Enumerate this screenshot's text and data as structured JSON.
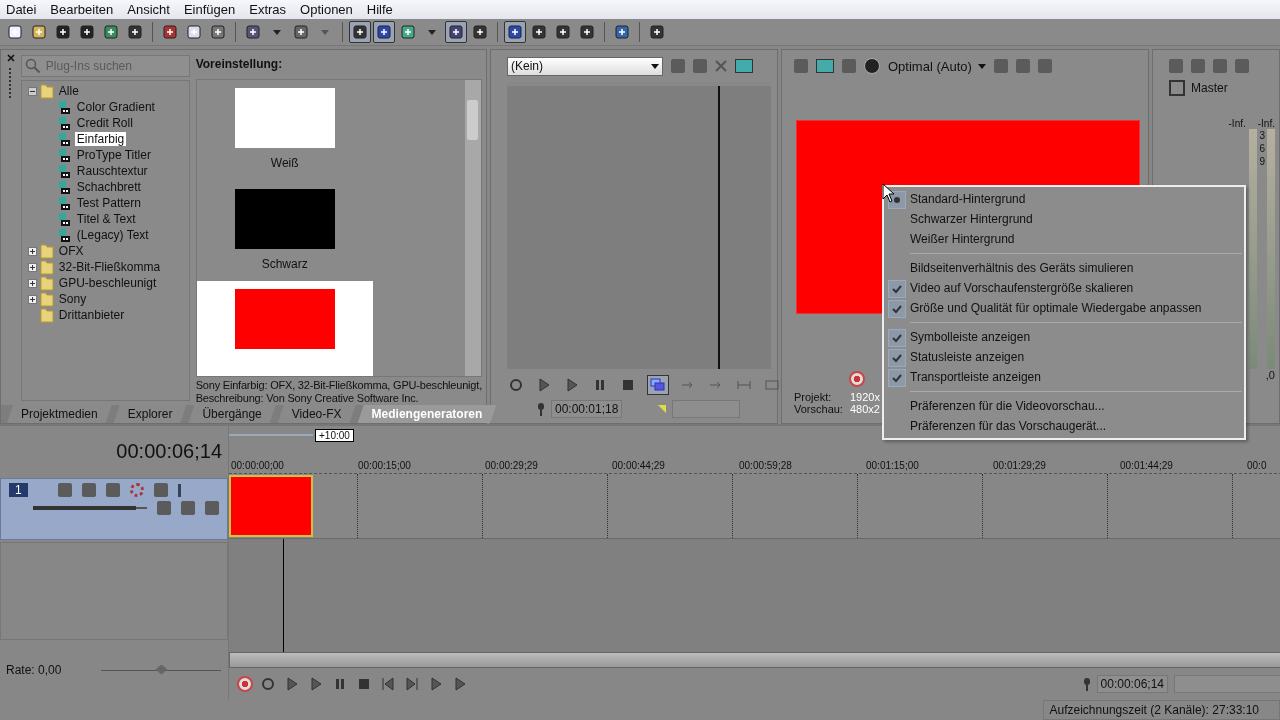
{
  "menu": [
    "Datei",
    "Bearbeiten",
    "Ansicht",
    "Einfügen",
    "Extras",
    "Optionen",
    "Hilfe"
  ],
  "toolbar": [
    {
      "pressed": false
    },
    {
      "pressed": false
    },
    {
      "pressed": false
    },
    {
      "pressed": false
    },
    {
      "pressed": false
    },
    {
      "pressed": false
    },
    {
      "pressed": false
    },
    {
      "pressed": false
    },
    {
      "pressed": false
    },
    {
      "pressed": false
    },
    {
      "pressed": false
    },
    {
      "pressed": false
    },
    {
      "pressed": false
    },
    {
      "pressed": true
    },
    {
      "pressed": true
    },
    {
      "pressed": false
    },
    {
      "pressed": false
    },
    {
      "pressed": true
    },
    {
      "pressed": false
    },
    {
      "pressed": true
    },
    {
      "pressed": false
    },
    {
      "pressed": false
    },
    {
      "pressed": false
    },
    {
      "pressed": false
    },
    {
      "pressed": false
    }
  ],
  "plugins": {
    "search": {
      "placeholder": "Plug-Ins suchen"
    },
    "tree": [
      {
        "label": "Alle",
        "expanded": true,
        "selected": false,
        "children": [
          {
            "label": "Color Gradient",
            "selected": false
          },
          {
            "label": "Credit Roll",
            "selected": false
          },
          {
            "label": "Einfarbig",
            "selected": true
          },
          {
            "label": "ProType Titler",
            "selected": false
          },
          {
            "label": "Rauschtextur",
            "selected": false
          },
          {
            "label": "Schachbrett",
            "selected": false
          },
          {
            "label": "Test Pattern",
            "selected": false
          },
          {
            "label": "Titel & Text",
            "selected": false
          },
          {
            "label": "(Legacy) Text",
            "selected": false
          }
        ]
      },
      {
        "label": "OFX",
        "expanded": false,
        "selected": false
      },
      {
        "label": "32-Bit-Fließkomma",
        "expanded": false,
        "selected": false
      },
      {
        "label": "GPU-beschleunigt",
        "expanded": false,
        "selected": false
      },
      {
        "label": "Sony",
        "expanded": false,
        "selected": false
      },
      {
        "label": "Drittanbieter",
        "selected": false
      }
    ],
    "presets_heading": "Voreinstellung:",
    "presets": [
      {
        "label": "Weiß",
        "color": "#ffffff",
        "selected": false
      },
      {
        "label": "Schwarz",
        "color": "#000000",
        "selected": false
      },
      {
        "color": "#ff0000",
        "selected": true
      }
    ],
    "description": [
      "Sony Einfarbig: OFX, 32-Bit-Fließkomma, GPU-beschleunigt,",
      "Beschreibung: Von Sony Creative Software Inc."
    ]
  },
  "tabs": [
    {
      "label": "Projektmedien",
      "selected": false
    },
    {
      "label": "Explorer",
      "selected": false
    },
    {
      "label": "Übergänge",
      "selected": false
    },
    {
      "label": "Video-FX",
      "selected": false
    },
    {
      "label": "Mediengeneratoren",
      "selected": true
    }
  ],
  "trimmer": {
    "source": "(Kein)",
    "timecode": "00:00:01;18"
  },
  "preview": {
    "quality": "Optimal (Auto)",
    "info": [
      {
        "label": "Projekt:",
        "value": "1920x"
      },
      {
        "label": "Vorschau:",
        "value": "480x2"
      }
    ]
  },
  "mixer": {
    "title": "Master",
    "peaks": [
      "-Inf.",
      "-Inf."
    ],
    "scale": [
      "3",
      "6",
      "9"
    ],
    "reading": ",0"
  },
  "context_menu": {
    "groups": [
      [
        {
          "kind": "radio",
          "label": "Standard-Hintergrund",
          "checked": true
        },
        {
          "kind": "radio",
          "label": "Schwarzer Hintergrund",
          "checked": false
        },
        {
          "kind": "radio",
          "label": "Weißer Hintergrund",
          "checked": false
        }
      ],
      [
        {
          "kind": "check",
          "label": "Bildseitenverhältnis des Geräts simulieren",
          "checked": false
        },
        {
          "kind": "check",
          "label": "Video auf Vorschaufenstergröße skalieren",
          "checked": true
        },
        {
          "kind": "check",
          "label": "Größe und Qualität für optimale Wiedergabe anpassen",
          "checked": true
        }
      ],
      [
        {
          "kind": "check",
          "label": "Symbolleiste anzeigen",
          "checked": true
        },
        {
          "kind": "check",
          "label": "Statusleiste anzeigen",
          "checked": true
        },
        {
          "kind": "check",
          "label": "Transportleiste anzeigen",
          "checked": true
        }
      ],
      [
        {
          "kind": "command",
          "label": "Präferenzen für die Videovorschau..."
        },
        {
          "kind": "command",
          "label": "Präferenzen für das Vorschaugerät..."
        }
      ]
    ]
  },
  "timeline": {
    "timecode": "00:00:06;14",
    "loop_length": "+10:00",
    "ruler": [
      "00:00:00;00",
      "00:00:15;00",
      "00:00:29;29",
      "00:00:44;29",
      "00:00:59;28",
      "00:01:15;00",
      "00:01:29;29",
      "00:01:44;29",
      "00:0"
    ],
    "track": {
      "number": "1",
      "selected": true,
      "level": 0.9
    },
    "rate": "Rate: 0,00",
    "rate_slider": {
      "level": 0.5
    },
    "cursor_time": "00:00:06;14"
  },
  "status_bar": "Aufzeichnungszeit (2 Kanäle): 27:33:10"
}
